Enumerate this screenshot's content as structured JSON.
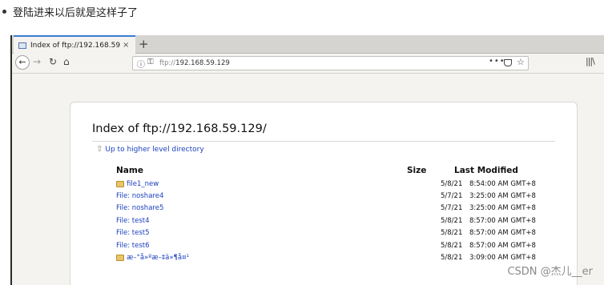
{
  "note": {
    "text": "登陆进来以后就是这样子了"
  },
  "browser": {
    "tab": {
      "title": "Index of ftp://192.168.59",
      "close": "×"
    },
    "new_tab": "+",
    "nav": {
      "back": "←",
      "forward": "→",
      "reload": "↻",
      "home": "⌂"
    },
    "url": {
      "scheme": "ftp://",
      "host": "192.168.59.129"
    },
    "icons": [
      "info-icon",
      "key-icon",
      "page-actions-icon",
      "pocket-icon",
      "bookmark-star-icon",
      "library-icon"
    ]
  },
  "listing": {
    "title": "Index of ftp://192.168.59.129/",
    "up_link": "Up to higher level directory",
    "headers": {
      "name": "Name",
      "size": "Size",
      "modified": "Last Modified"
    },
    "rows": [
      {
        "type": "folder",
        "name": "file1_new",
        "date": "5/8/21",
        "time": "8:54:00 AM GMT+8"
      },
      {
        "type": "file",
        "name": "File: noshare4",
        "date": "5/7/21",
        "time": "3:25:00 AM GMT+8"
      },
      {
        "type": "file",
        "name": "File: noshare5",
        "date": "5/7/21",
        "time": "3:25:00 AM GMT+8"
      },
      {
        "type": "file",
        "name": "File: test4",
        "date": "5/8/21",
        "time": "8:57:00 AM GMT+8"
      },
      {
        "type": "file",
        "name": "File: test5",
        "date": "5/8/21",
        "time": "8:57:00 AM GMT+8"
      },
      {
        "type": "file",
        "name": "File: test6",
        "date": "5/8/21",
        "time": "8:57:00 AM GMT+8"
      },
      {
        "type": "folder",
        "name": "æ–°å»ºæ–‡ä»¶å¤¹",
        "date": "5/8/21",
        "time": "3:09:00 AM GMT+8"
      }
    ]
  },
  "watermark": {
    "text": "CSDN @杰儿__er"
  }
}
